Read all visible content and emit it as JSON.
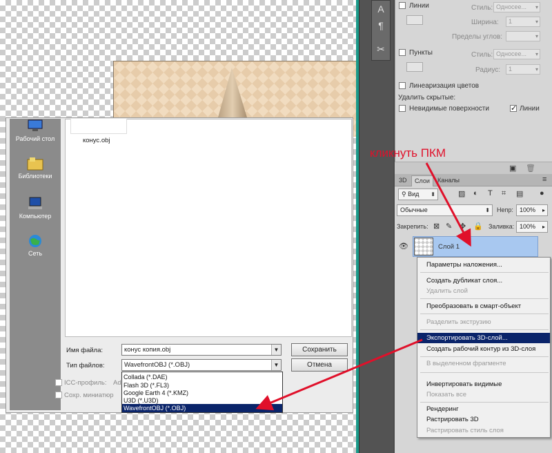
{
  "props": {
    "lines_label": "Линии",
    "style_label": "Стиль:",
    "style_value": "Односее...",
    "width_label": "Ширина:",
    "width_value": "1",
    "angle_label": "Пределы углов:",
    "points_label": "Пункты",
    "radius_label": "Радиус:",
    "radius_value": "1",
    "linearize_label": "Линеаризация цветов",
    "remove_hidden_label": "Удалить скрытые:",
    "hidden_surfaces_label": "Невидимые поверхности",
    "lines_check_label": "Линии"
  },
  "layers": {
    "tabs": [
      "3D",
      "Слои",
      "Каналы"
    ],
    "kind_label": "Вид",
    "blend_mode": "Обычные",
    "opacity_label": "Непр:",
    "opacity_value": "100%",
    "lock_label": "Закрепить:",
    "fill_label": "Заливка:",
    "fill_value": "100%",
    "layer_name": "Слой 1"
  },
  "context_menu": {
    "items": [
      {
        "label": "Параметры наложения...",
        "state": "normal"
      },
      {
        "label": "Создать дубликат слоя...",
        "state": "normal"
      },
      {
        "label": "Удалить слой",
        "state": "disabled"
      },
      {
        "label": "Преобразовать в смарт-объект",
        "state": "normal"
      },
      {
        "label": "Разделить экструзию",
        "state": "disabled"
      },
      {
        "label": "Экспортировать 3D-слой...",
        "state": "highlighted"
      },
      {
        "label": "Создать рабочий контур из 3D-слоя",
        "state": "normal"
      },
      {
        "label": "В выделенном фрагменте",
        "state": "disabled"
      },
      {
        "label": "Инвертировать видимые",
        "state": "normal"
      },
      {
        "label": "Показать все",
        "state": "disabled"
      },
      {
        "label": "Рендеринг",
        "state": "normal"
      },
      {
        "label": "Растрировать 3D",
        "state": "normal"
      },
      {
        "label": "Растрировать стиль слоя",
        "state": "disabled"
      }
    ]
  },
  "dialog": {
    "places": [
      "Рабочий стол",
      "Библиотеки",
      "Компьютер",
      "Сеть"
    ],
    "file_item": "конус.obj",
    "filename_label": "Имя файла:",
    "filename_value": "конус копия.obj",
    "filetype_label": "Тип файлов:",
    "filetype_value": "WavefrontOBJ (*.OBJ)",
    "save_button": "Сохранить",
    "cancel_button": "Отмена",
    "icc_label": "ICC-профиль:",
    "icc_suffix": "Ad",
    "thumbnail_label": "Сохр. миниатюр",
    "type_options": [
      {
        "label": "Collada (*.DAE)",
        "selected": false
      },
      {
        "label": "Flash 3D (*.FL3)",
        "selected": false
      },
      {
        "label": "Google Earth 4 (*.KMZ)",
        "selected": false
      },
      {
        "label": "U3D (*.U3D)",
        "selected": false
      },
      {
        "label": "WavefrontOBJ (*.OBJ)",
        "selected": true
      }
    ]
  },
  "annotation": {
    "text": "кликнуть ПКМ",
    "color": "#e0102a"
  },
  "colors": {
    "highlight": "#0a246a",
    "layer_selected": "#a8c8f0"
  }
}
